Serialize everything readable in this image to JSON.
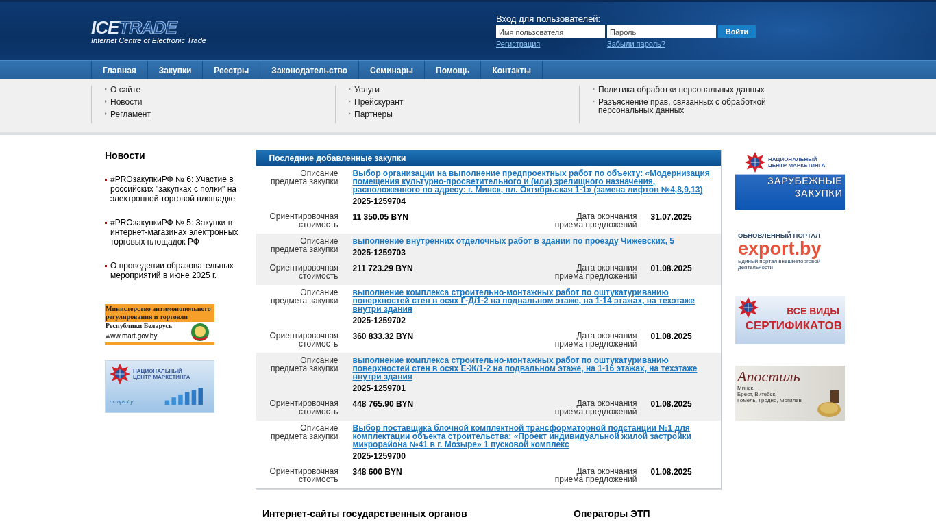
{
  "logo": {
    "word_a": "ICE",
    "word_b": "TRADE",
    "tagline": "Internet Centre of Electronic Trade"
  },
  "login": {
    "title": "Вход для пользователей:",
    "username_placeholder": "Имя пользователя",
    "password_placeholder": "Пароль",
    "button": "Войти",
    "register_link": "Регистрация",
    "forgot_link": "Забыли пароль?"
  },
  "nav": [
    "Главная",
    "Закупки",
    "Реестры",
    "Законодательство",
    "Семинары",
    "Помощь",
    "Контакты"
  ],
  "submenu": [
    [
      "О сайте",
      "Новости",
      "Регламент"
    ],
    [
      "Услуги",
      "Прейскурант",
      "Партнеры"
    ],
    [
      "Политика обработки персональных данных",
      "Разъяснение прав, связанных с обработкой персональных данных"
    ]
  ],
  "news": {
    "title": "Новости",
    "items": [
      "#PROзакупкиРФ № 6: Участие в российских \"закупках с полки\" на электронной торговой площадке",
      "#PROзакупкиРФ № 5: Закупки в интернет-магазинах электронных торговых площадок РФ",
      "О проведении образовательных мероприятий в июне 2025 г."
    ]
  },
  "left_banners": [
    {
      "kind": "mart",
      "lines": [
        "Министерство антимонопольного",
        "регулирования и торговли",
        "Республики Беларусь",
        "www.mart.gov.by"
      ]
    },
    {
      "kind": "ncm",
      "lines": [
        "НАЦИОНАЛЬНЫЙ",
        "ЦЕНТР МАРКЕТИНГА",
        "ncmps.by"
      ]
    }
  ],
  "tenders": {
    "title": "Последние добавленные закупки",
    "rows": [
      {
        "desc_label": "Описание предмета закупки",
        "description": "Выбор организации на выполнение предпроектных работ по объекту: «Модернизация помещения культурно-просветительного и (или) зрелищного назначения, расположенного по адресу: г. Минск, пл. Октябрьская 1-1» (замена лифтов №4,8,9,13)",
        "number": "2025-1259704",
        "cost_label": "Ориентировочная стоимость",
        "cost": "11 350.05 BYN",
        "date_label": "Дата окончания приема предложений",
        "date": "31.07.2025"
      },
      {
        "desc_label": "Описание предмета закупки",
        "description": "выполнение внутренних отделочных работ в здании по проезду Чижевских, 5",
        "number": "2025-1259703",
        "cost_label": "Ориентировочная стоимость",
        "cost": "211 723.29 BYN",
        "date_label": "Дата окончания приема предложений",
        "date": "01.08.2025"
      },
      {
        "desc_label": "Описание предмета закупки",
        "description": "выполнение комплекса строительно-монтажных работ по оштукатуриванию поверхностей стен в осях Г-Д/1-2 на подвальном этаже, на 1-14 этажах, на техэтаже внутри здания",
        "number": "2025-1259702",
        "cost_label": "Ориентировочная стоимость",
        "cost": "360 833.32 BYN",
        "date_label": "Дата окончания приема предложений",
        "date": "01.08.2025"
      },
      {
        "desc_label": "Описание предмета закупки",
        "description": "выполнение комплекса строительно-монтажных работ по оштукатуриванию поверхностей стен в осях Е-Ж/1-2 на подвальном этаже, на 1-16 этажах, на техэтаже внутри здания",
        "number": "2025-1259701",
        "cost_label": "Ориентировочная стоимость",
        "cost": "448 765.90 BYN",
        "date_label": "Дата окончания приема предложений",
        "date": "01.08.2025"
      },
      {
        "desc_label": "Описание предмета закупки",
        "description": "Выбор поставщика блочной комплектной трансформаторной подстанции №1 для комплектации объекта строительства: «Проект индивидуальной жилой застройки микрорайона №41 в г. Мозыре» 1 пусковой комплекс",
        "number": "2025-1259700",
        "cost_label": "Ориентировочная стоимость",
        "cost": "348 600 BYN",
        "date_label": "Дата окончания приема предложений",
        "date": "01.08.2025"
      }
    ]
  },
  "right_banners": [
    {
      "kind": "foreign",
      "lines": [
        "НАЦИОНАЛЬНЫЙ",
        "ЦЕНТР МАРКЕТИНГА",
        "ЗАРУБЕЖНЫЕ",
        "ЗАКУПКИ"
      ]
    },
    {
      "kind": "export",
      "lines": [
        "ОБНОВЛЕННЫЙ ПОРТАЛ",
        "export.by",
        "Единый портал внешнеторговой деятельности"
      ]
    },
    {
      "kind": "certs",
      "lines": [
        "ВСЕ ВИДЫ",
        "СЕРТИФИКАТОВ"
      ]
    },
    {
      "kind": "apostille",
      "lines": [
        "Апостиль",
        "Минск,",
        "Брест, Витебск,",
        "Гомель, Гродно, Могилев"
      ]
    }
  ],
  "footer_headings": [
    "Интернет-сайты государственных органов",
    "Операторы ЭТП"
  ]
}
